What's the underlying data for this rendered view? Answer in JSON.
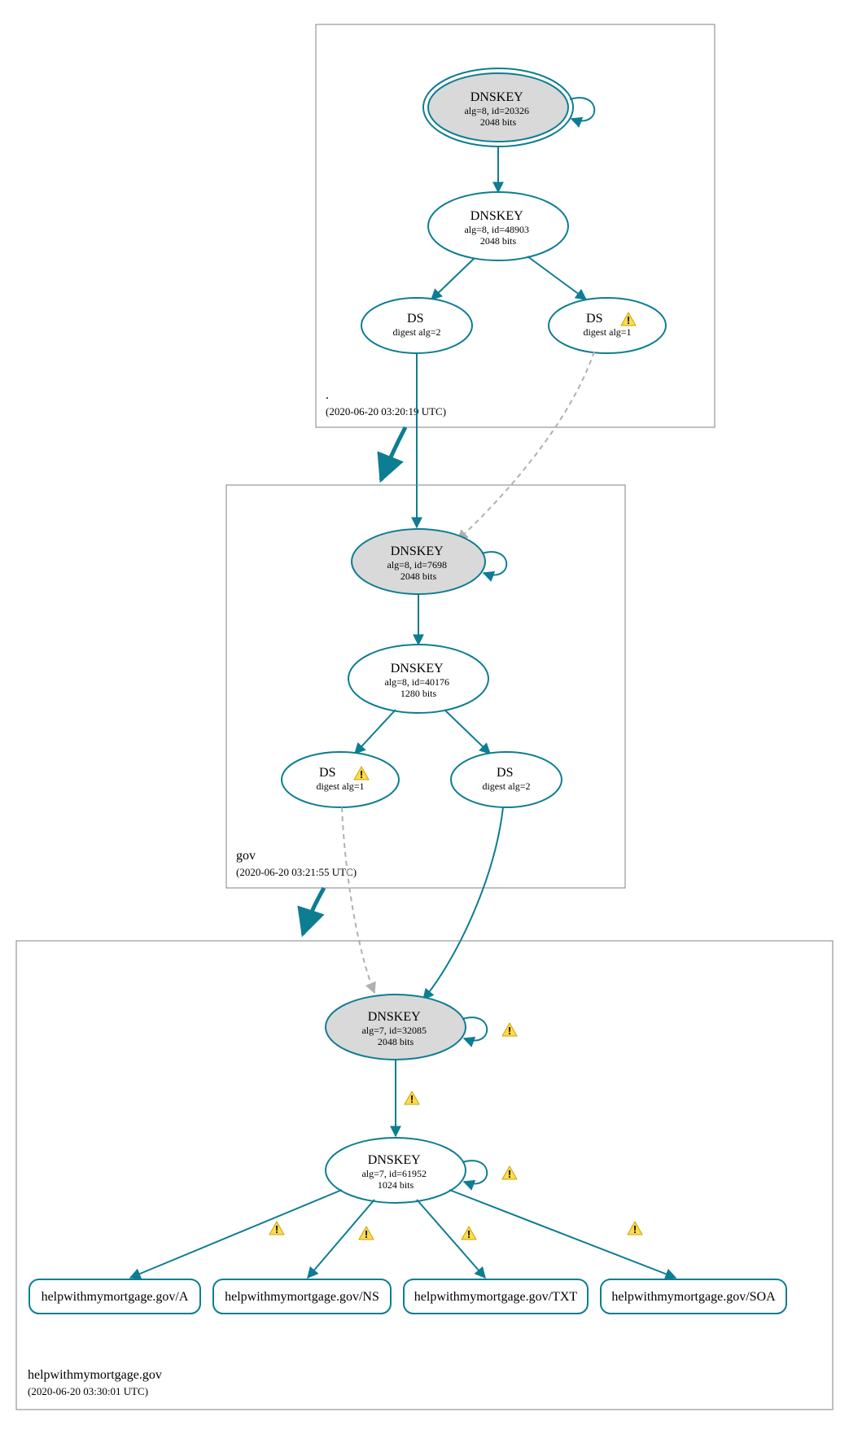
{
  "colors": {
    "teal": "#0d7d92",
    "gray": "#b0b0b0",
    "warnFill": "#ffdb4d",
    "warnStroke": "#c9a400"
  },
  "zones": {
    "root": {
      "title": ".",
      "time": "(2020-06-20 03:20:19 UTC)"
    },
    "gov": {
      "title": "gov",
      "time": "(2020-06-20 03:21:55 UTC)"
    },
    "domain": {
      "title": "helpwithmymortgage.gov",
      "time": "(2020-06-20 03:30:01 UTC)"
    }
  },
  "nodes": {
    "root_ksk": {
      "l1": "DNSKEY",
      "l2": "alg=8, id=20326",
      "l3": "2048 bits"
    },
    "root_zsk": {
      "l1": "DNSKEY",
      "l2": "alg=8, id=48903",
      "l3": "2048 bits"
    },
    "root_ds1": {
      "l1": "DS",
      "l2": "digest alg=2"
    },
    "root_ds2": {
      "l1": "DS",
      "l2": "digest alg=1"
    },
    "gov_ksk": {
      "l1": "DNSKEY",
      "l2": "alg=8, id=7698",
      "l3": "2048 bits"
    },
    "gov_zsk": {
      "l1": "DNSKEY",
      "l2": "alg=8, id=40176",
      "l3": "1280 bits"
    },
    "gov_ds1": {
      "l1": "DS",
      "l2": "digest alg=1"
    },
    "gov_ds2": {
      "l1": "DS",
      "l2": "digest alg=2"
    },
    "dom_ksk": {
      "l1": "DNSKEY",
      "l2": "alg=7, id=32085",
      "l3": "2048 bits"
    },
    "dom_zsk": {
      "l1": "DNSKEY",
      "l2": "alg=7, id=61952",
      "l3": "1024 bits"
    }
  },
  "rrsets": {
    "a": "helpwithmymortgage.gov/A",
    "ns": "helpwithmymortgage.gov/NS",
    "txt": "helpwithmymortgage.gov/TXT",
    "soa": "helpwithmymortgage.gov/SOA"
  }
}
